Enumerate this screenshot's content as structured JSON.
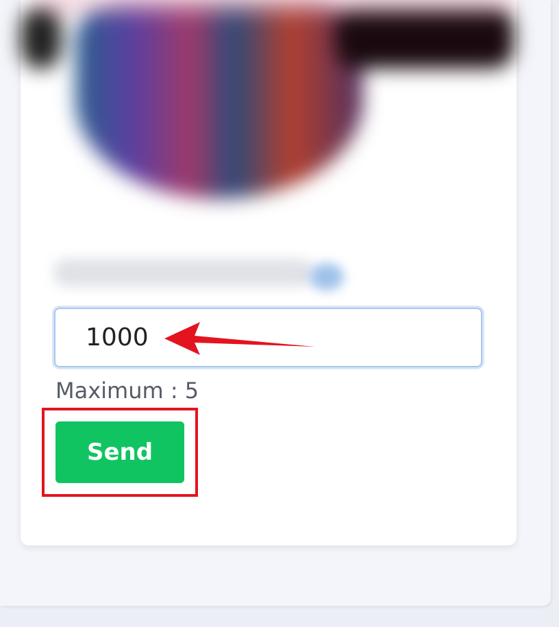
{
  "form": {
    "amount_value": "1000",
    "maximum_label": "Maximum : 5",
    "send_label": "Send"
  },
  "colors": {
    "send_button": "#11c462",
    "highlight_box": "#e3141f",
    "arrow": "#e3141f",
    "input_border": "#a9c7ef"
  },
  "icons": {
    "annotation": "red-arrow-pointing-left"
  }
}
